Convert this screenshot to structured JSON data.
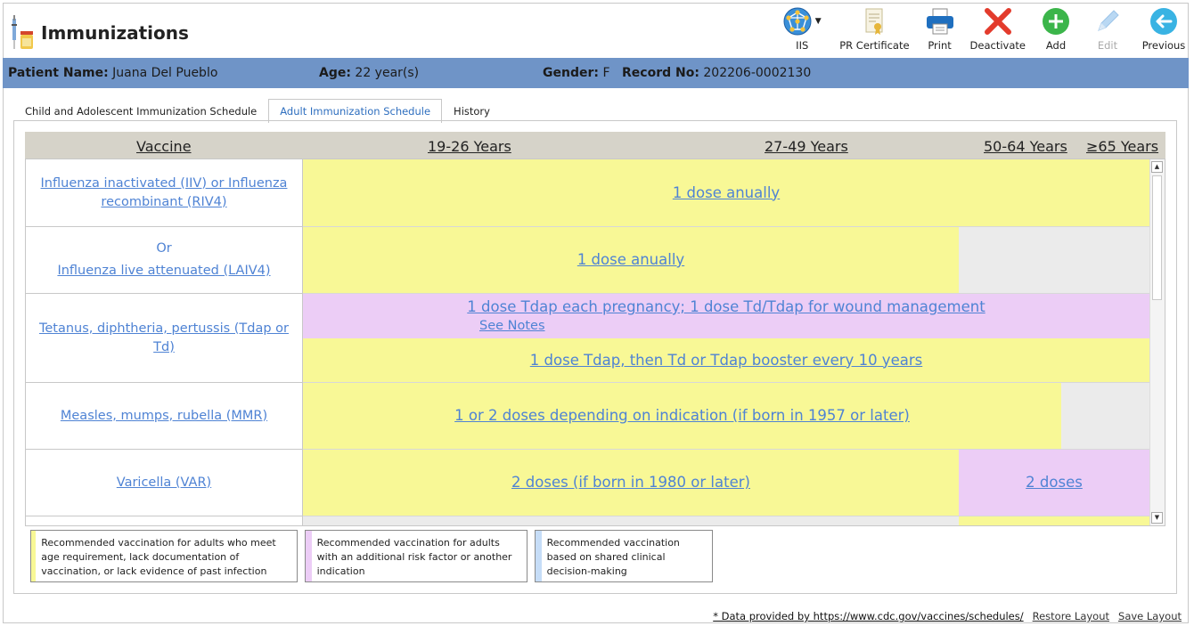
{
  "app": {
    "title": "Immunizations"
  },
  "toolbar": {
    "iis_label": "IIS",
    "pr_certificate_label": "PR Certificate",
    "print_label": "Print",
    "deactivate_label": "Deactivate",
    "add_label": "Add",
    "edit_label": "Edit",
    "previous_label": "Previous"
  },
  "patient": {
    "name_label": "Patient Name:",
    "name_value": "Juana Del Pueblo",
    "age_label": "Age:",
    "age_value": "22 year(s)",
    "gender_label": "Gender:",
    "gender_value": "F",
    "record_label": "Record No:",
    "record_value": "202206-0002130"
  },
  "tabs": [
    {
      "label": "Child and Adolescent Immunization Schedule",
      "active": false
    },
    {
      "label": "Adult Immunization Schedule",
      "active": true
    },
    {
      "label": "History",
      "active": false
    }
  ],
  "grid": {
    "headers": {
      "vaccine": "Vaccine",
      "c1": "19-26 Years",
      "c2": "27-49 Years",
      "c3": "50-64 Years",
      "c4": "≥65 Years"
    },
    "rows": [
      {
        "vaccine": "Influenza inactivated (IIV) or Influenza recombinant (RIV4)",
        "bars": [
          "1 dose anually"
        ]
      },
      {
        "or_text": "Or",
        "vaccine": "Influenza live attenuated (LAIV4)",
        "bars": [
          "1 dose anually"
        ]
      },
      {
        "vaccine": "Tetanus, diphtheria, pertussis (Tdap or Td)",
        "bars": [
          "1 dose Tdap each pregnancy; 1 dose Td/Tdap for wound management",
          "1 dose Tdap, then Td or Tdap booster every 10 years"
        ],
        "note": "See Notes"
      },
      {
        "vaccine": "Measles, mumps, rubella (MMR)",
        "bars": [
          "1 or 2 doses depending on indication (if born in 1957 or later)"
        ]
      },
      {
        "vaccine": "Varicella (VAR)",
        "bars": [
          "2 doses (if born in 1980 or later)",
          "2 doses"
        ]
      }
    ]
  },
  "legend": [
    {
      "color": "#f8f896",
      "text": "Recommended vaccination for adults who meet age requirement, lack documentation of vaccination, or lack evidence of past infection"
    },
    {
      "color": "#eccdf6",
      "text": "Recommended vaccination for adults with an additional risk factor or another indication"
    },
    {
      "color": "#c6ddf7",
      "text": "Recommended vaccination based on shared clinical decision-making"
    }
  ],
  "footer": {
    "data_note": "* Data provided by https://www.cdc.gov/vaccines/schedules/",
    "restore_layout": "Restore Layout",
    "save_layout": "Save Layout"
  },
  "colors": {
    "header_bar": "#6f94c7",
    "link": "#4f83d4",
    "yellow": "#f8f896",
    "purple": "#eccdf6",
    "gray": "#ebebeb"
  },
  "icons": [
    "syringe-vial-icon",
    "globe-network-icon",
    "certificate-icon",
    "printer-icon",
    "deactivate-x-icon",
    "add-plus-icon",
    "edit-pencil-icon",
    "previous-arrow-icon"
  ]
}
